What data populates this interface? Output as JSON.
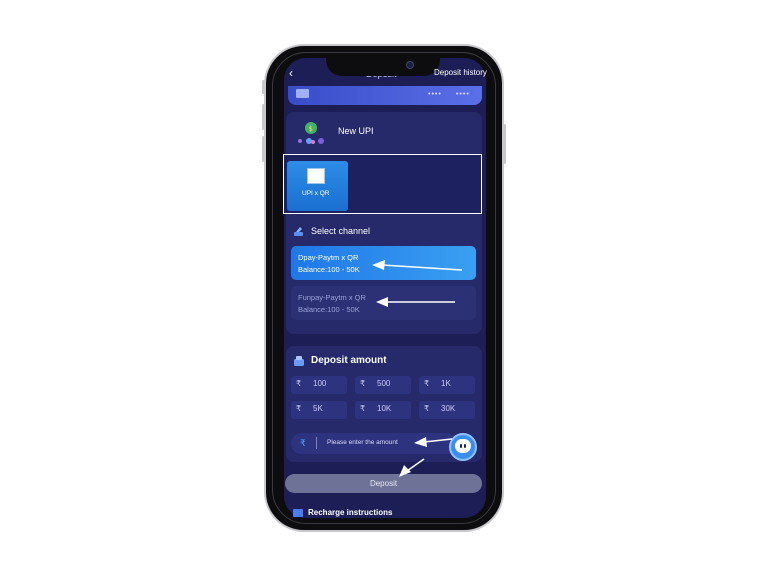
{
  "header": {
    "back_symbol": "‹",
    "title": "Deposit",
    "history_label": "Deposit history"
  },
  "card": {
    "dots_left": "••••",
    "dots_right": "••••"
  },
  "upi": {
    "title": "New UPI",
    "tile_label": "UPI x QR"
  },
  "channel": {
    "title": "Select channel",
    "items": [
      {
        "name": "Dpay-Paytm x QR",
        "balance": "Balance:100 - 50K"
      },
      {
        "name": "Funpay-Paytm x QR",
        "balance": "Balance:100 - 50K"
      }
    ]
  },
  "deposit_amount": {
    "title": "Deposit amount",
    "currency": "₹",
    "options": [
      "100",
      "500",
      "1K",
      "5K",
      "10K",
      "30K"
    ],
    "input_placeholder": "Please enter the amount"
  },
  "deposit_button_label": "Deposit",
  "recharge_title": "Recharge instructions",
  "colors": {
    "background": "#1c1e55",
    "panel": "#262a6a",
    "accent_blue": "#1f78e8",
    "deposit_button": "#6e7296"
  }
}
